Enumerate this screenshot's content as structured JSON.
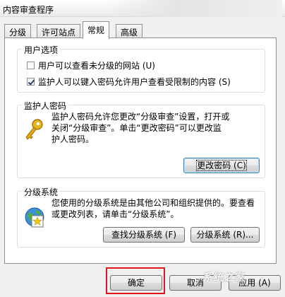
{
  "window": {
    "title": "内容审查程序"
  },
  "tabs": [
    {
      "label": "分级",
      "active": false
    },
    {
      "label": "许可站点",
      "active": false
    },
    {
      "label": "常规",
      "active": true
    },
    {
      "label": "高级",
      "active": false
    }
  ],
  "user_options": {
    "title": "用户选项",
    "opt1": {
      "label": "用户可以查看未分级的网站 (U)",
      "checked": false
    },
    "opt2": {
      "label": "监护人可以键入密码允许用户查看受限制的内容 (S)",
      "checked": true
    }
  },
  "supervisor": {
    "title": "监护人密码",
    "desc_lines": [
      "监护人密码允许您更改“分级审查”设置，打开或",
      "关闭“分级审查”。单击“更改密码”可以更改监",
      "护人密码。"
    ],
    "change_password_label": "更改密码 (C)"
  },
  "rating_systems": {
    "title": "分级系统",
    "desc_lines": [
      "您使用的分级系统是由其他公司和组织提供的。要查看",
      "或更改列表，请单击“分级系统”。"
    ],
    "find_label": "查找分级系统 (F)",
    "systems_label": "分级系统 (R)..."
  },
  "footer": {
    "ok_label": "确定",
    "cancel_label": "取消",
    "apply_label": "应用 (A)"
  },
  "watermark": "系统之家",
  "colors": {
    "highlight": "#e0151b",
    "focus_border": "#3c7fb1"
  }
}
